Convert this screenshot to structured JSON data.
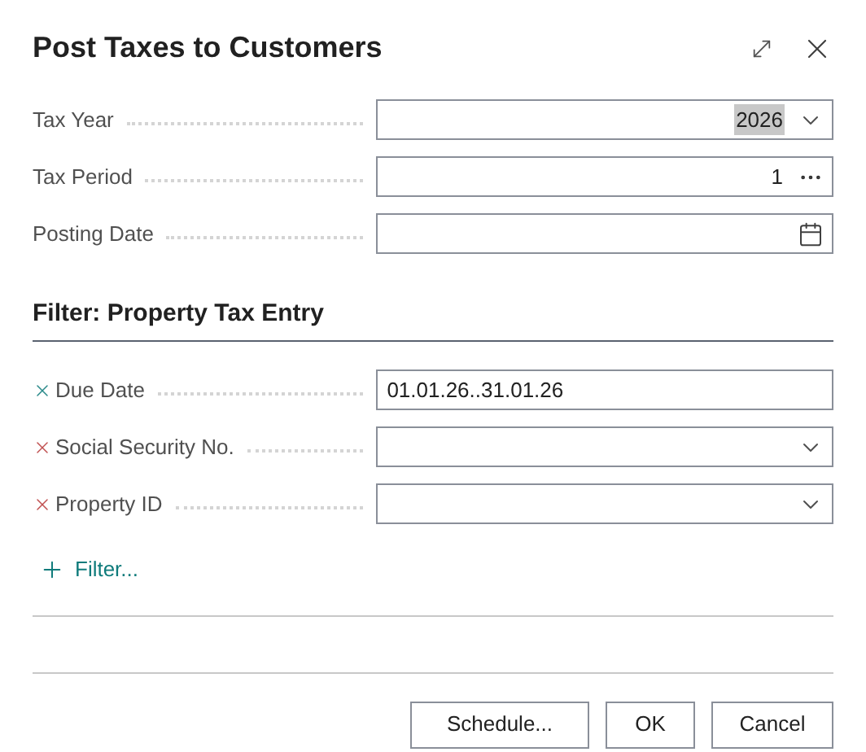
{
  "window": {
    "title": "Post Taxes to Customers"
  },
  "fields": [
    {
      "label": "Tax Year",
      "value": "2026",
      "kind": "dropdown",
      "highlighted": true
    },
    {
      "label": "Tax Period",
      "value": "1",
      "kind": "lookup"
    },
    {
      "label": "Posting Date",
      "kind": "date"
    }
  ],
  "filter_section": {
    "title": "Filter: Property Tax Entry",
    "filters": [
      {
        "label": "Due Date",
        "value": "01.01.26..31.01.26",
        "kind": "text",
        "applied": true
      },
      {
        "label": "Social Security No.",
        "kind": "dropdown",
        "applied": false
      },
      {
        "label": "Property ID",
        "kind": "dropdown",
        "applied": false
      }
    ],
    "add_filter": "Filter..."
  },
  "buttons": [
    "Schedule...",
    "OK",
    "Cancel"
  ]
}
